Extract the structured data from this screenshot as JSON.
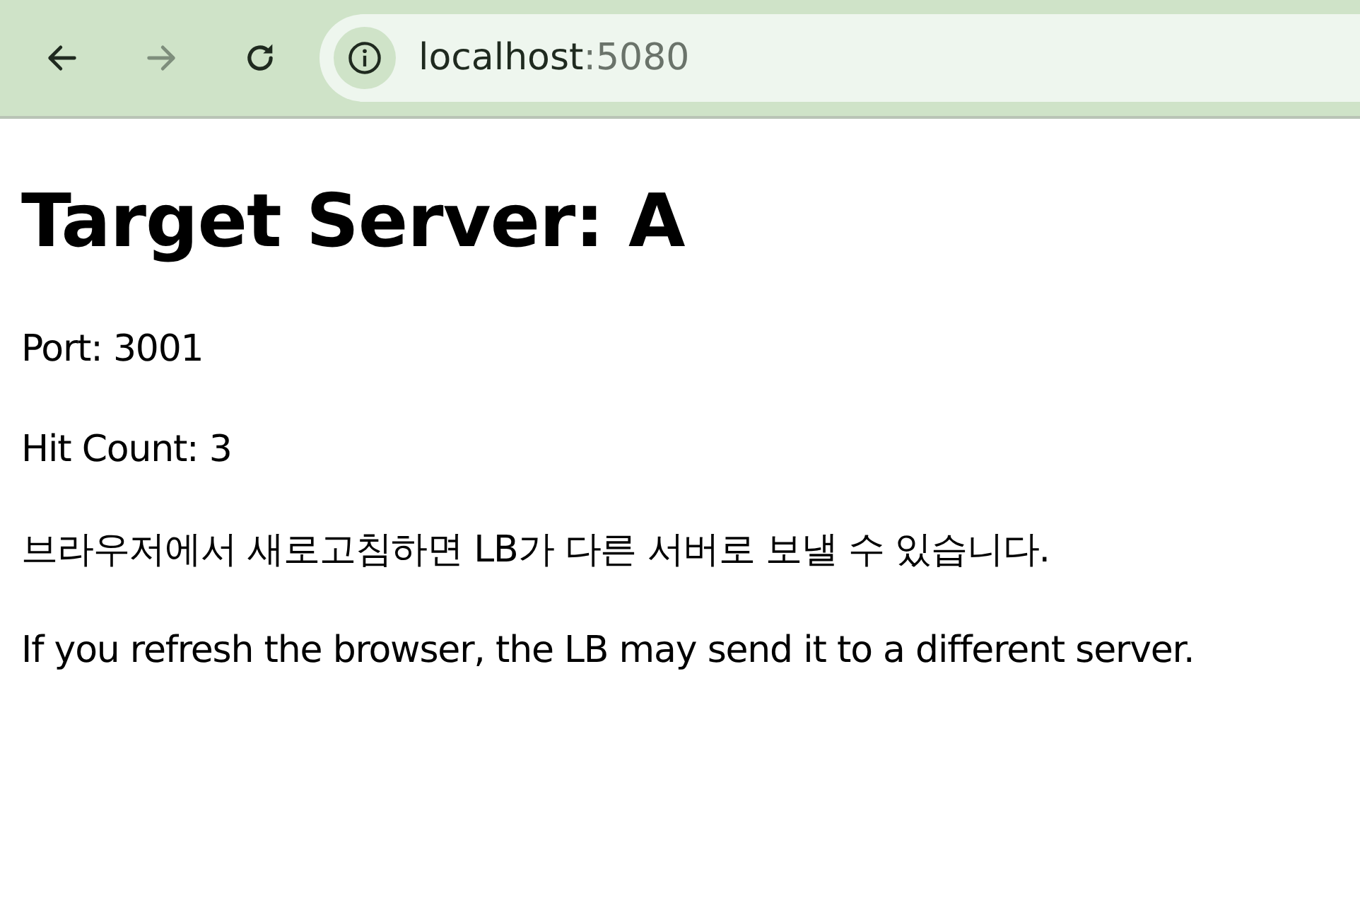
{
  "toolbar": {
    "buttons": [
      {
        "kind": "back",
        "disabled": false
      },
      {
        "kind": "forward",
        "disabled": true
      },
      {
        "kind": "reload",
        "disabled": false
      }
    ],
    "address": {
      "host": "localhost",
      "port": ":5080"
    }
  },
  "page": {
    "title": "Target Server: A",
    "paragraphs": [
      "Port: 3001",
      "Hit Count: 3",
      "브라우저에서 새로고침하면 LB가 다른 서버로 보낼 수 있습니다.",
      "If you refresh the browser, the LB may send it to a different server."
    ]
  }
}
